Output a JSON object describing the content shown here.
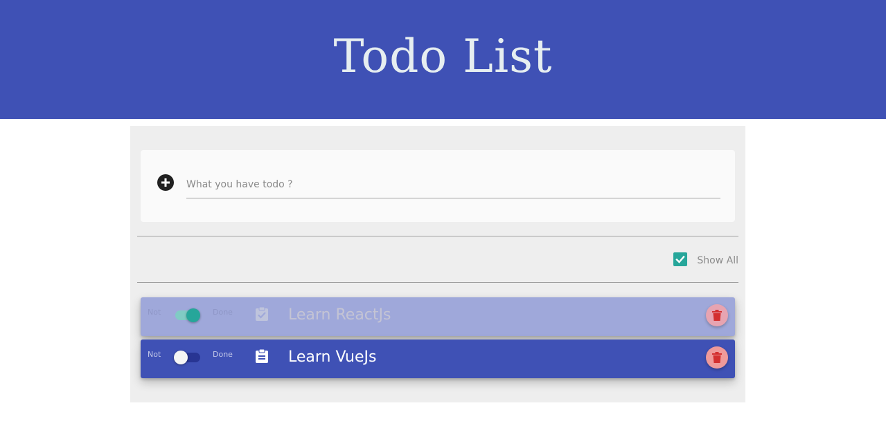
{
  "header": {
    "title": "Todo List"
  },
  "new_todo": {
    "placeholder": "What you have todo ?",
    "value": ""
  },
  "filter": {
    "show_all_label": "Show All",
    "checked": true
  },
  "todos": [
    {
      "text": "Learn ReactJs",
      "not_label": "Not",
      "done_label": "Done",
      "done": true,
      "icon": "clipboard-check-icon"
    },
    {
      "text": "Learn VueJs",
      "not_label": "Not",
      "done_label": "Done",
      "done": false,
      "icon": "clipboard-list-icon"
    }
  ],
  "colors": {
    "primary": "#3f51b5",
    "primary_light": "#9fa8da",
    "accent": "#26a69a",
    "delete": "#ef9a9a",
    "delete_icon": "#d32f2f"
  }
}
